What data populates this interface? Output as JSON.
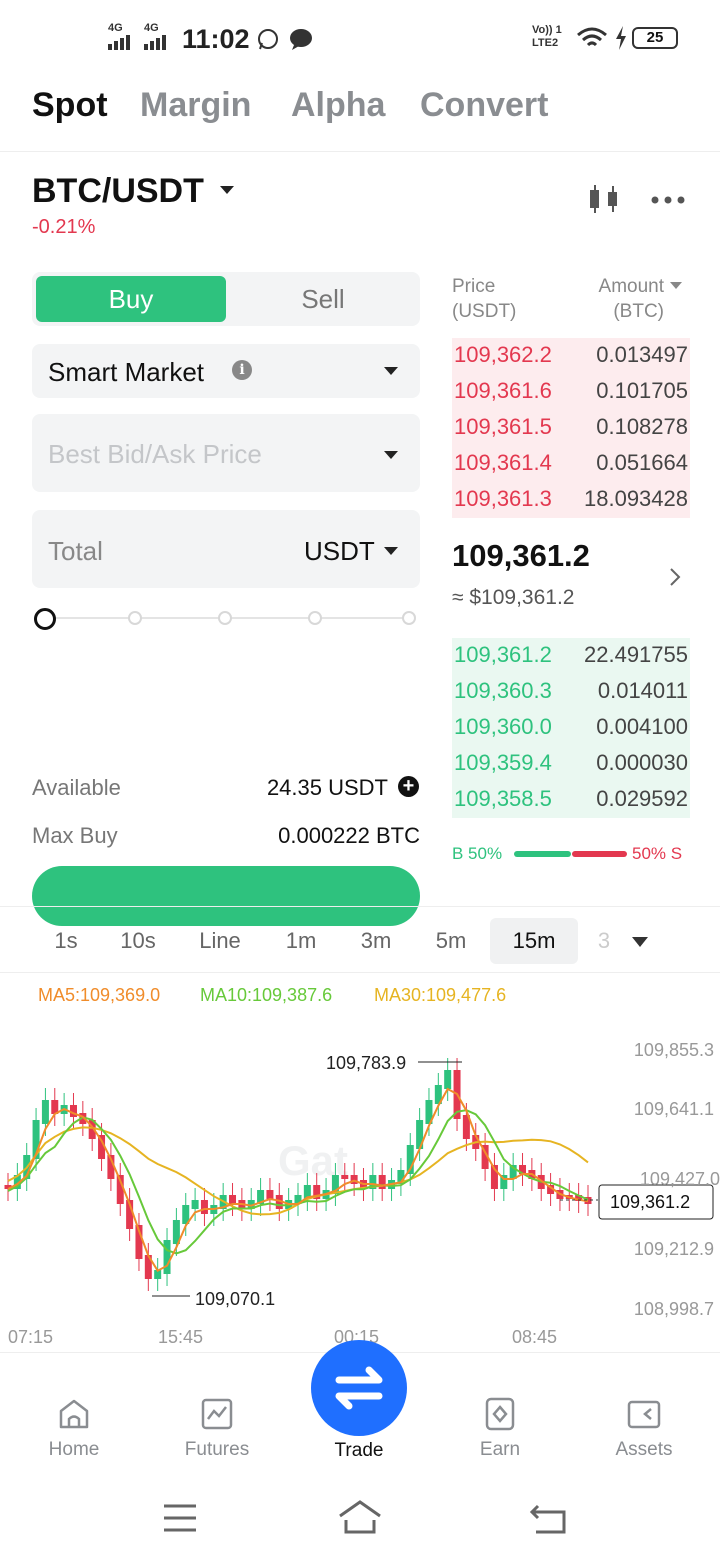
{
  "status_bar": {
    "net1": "4G",
    "net2": "4G",
    "time": "11:02",
    "volte": "Vo)) 1",
    "lte": "LTE2",
    "battery": "25"
  },
  "top_tabs": [
    "Spot",
    "Margin",
    "Alpha",
    "Convert"
  ],
  "active_tab": "Spot",
  "pair": {
    "name": "BTC/USDT",
    "change": "-0.21%"
  },
  "order_form": {
    "buy_label": "Buy",
    "sell_label": "Sell",
    "order_type": "Smart Market",
    "price_placeholder": "Best Bid/Ask Price",
    "total_label": "Total",
    "total_unit": "USDT",
    "available_label": "Available",
    "available_value": "24.35 USDT",
    "maxbuy_label": "Max Buy",
    "maxbuy_value": "0.000222 BTC"
  },
  "order_book": {
    "price_header": "Price",
    "price_unit": "(USDT)",
    "amount_header": "Amount",
    "amount_unit": "(BTC)",
    "asks": [
      {
        "price": "109,362.2",
        "amount": "0.013497"
      },
      {
        "price": "109,361.6",
        "amount": "0.101705"
      },
      {
        "price": "109,361.5",
        "amount": "0.108278"
      },
      {
        "price": "109,361.4",
        "amount": "0.051664"
      },
      {
        "price": "109,361.3",
        "amount": "18.093428"
      }
    ],
    "last_price": "109,361.2",
    "last_price_usd": "≈ $109,361.2",
    "bids": [
      {
        "price": "109,361.2",
        "amount": "22.491755"
      },
      {
        "price": "109,360.3",
        "amount": "0.014011"
      },
      {
        "price": "109,360.0",
        "amount": "0.004100"
      },
      {
        "price": "109,359.4",
        "amount": "0.000030"
      },
      {
        "price": "109,358.5",
        "amount": "0.029592"
      }
    ],
    "buy_ratio_label": "B 50%",
    "sell_ratio_label": "50% S",
    "buy_ratio": 0.5
  },
  "timeframes": [
    "1s",
    "10s",
    "Line",
    "1m",
    "3m",
    "5m",
    "15m",
    "3"
  ],
  "active_timeframe": "15m",
  "indicators": {
    "ma5": "MA5:109,369.0",
    "ma10": "MA10:109,387.6",
    "ma30": "MA30:109,477.6"
  },
  "chart_data": {
    "type": "candlestick",
    "y_ticks": [
      "109,855.3",
      "109,641.1",
      "109,427.0",
      "109,212.9",
      "108,998.7"
    ],
    "x_ticks": [
      "07:15",
      "15:45",
      "00:15",
      "08:45"
    ],
    "high_label": "109,783.9",
    "low_label": "109,070.1",
    "current_price": "109,361.2",
    "ylim": [
      108998.7,
      109855.3
    ],
    "series": [
      {
        "name": "MA5",
        "color": "#f08c2a"
      },
      {
        "name": "MA10",
        "color": "#67c93a"
      },
      {
        "name": "MA30",
        "color": "#e6b422"
      }
    ]
  },
  "bottom_nav": [
    {
      "label": "Home",
      "icon": "home-icon"
    },
    {
      "label": "Futures",
      "icon": "futures-icon"
    },
    {
      "label": "Trade",
      "icon": "trade-icon"
    },
    {
      "label": "Earn",
      "icon": "earn-icon"
    },
    {
      "label": "Assets",
      "icon": "assets-icon"
    }
  ],
  "colors": {
    "up": "#2ec27e",
    "down": "#e3384f",
    "accent": "#1f6fff"
  }
}
